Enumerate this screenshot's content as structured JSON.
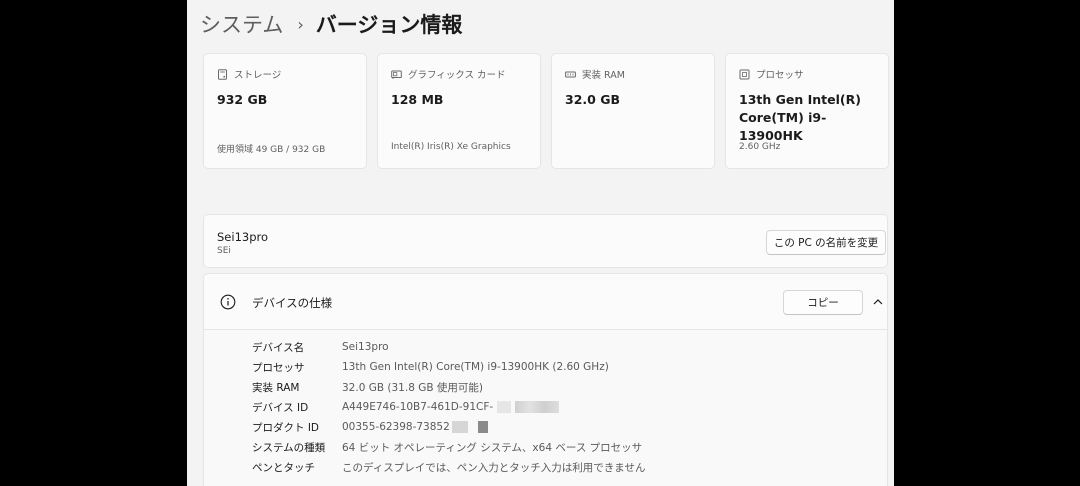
{
  "breadcrumb": {
    "parent": "システム",
    "separator": "›",
    "current": "バージョン情報"
  },
  "cards": [
    {
      "icon": "storage-icon",
      "label": "ストレージ",
      "value": "932 GB",
      "sub": "使用領域 49 GB / 932 GB"
    },
    {
      "icon": "graphics-card-icon",
      "label": "グラフィックス カード",
      "value": "128 MB",
      "sub": "Intel(R) Iris(R) Xe Graphics"
    },
    {
      "icon": "memory-icon",
      "label": "実装 RAM",
      "value": "32.0 GB",
      "sub": ""
    },
    {
      "icon": "processor-icon",
      "label": "プロセッサ",
      "value": "13th Gen Intel(R)\nCore(TM) i9-13900HK",
      "sub": "2.60 GHz"
    }
  ],
  "pc": {
    "name": "Sei13pro",
    "model": "SEi",
    "rename_label": "この PC の名前を変更"
  },
  "device_specs": {
    "title": "デバイスの仕様",
    "copy_label": "コピー",
    "expanded": true,
    "rows": [
      {
        "key": "デバイス名",
        "value": "Sei13pro"
      },
      {
        "key": "プロセッサ",
        "value": "13th Gen Intel(R) Core(TM) i9-13900HK (2.60 GHz)"
      },
      {
        "key": "実装 RAM",
        "value": "32.0 GB (31.8 GB 使用可能)"
      },
      {
        "key": "デバイス ID",
        "value": "A449E746-10B7-461D-91CF-"
      },
      {
        "key": "プロダクト ID",
        "value": "00355-62398-73852"
      },
      {
        "key": "システムの種類",
        "value": "64 ビット オペレーティング システム、x64 ベース プロセッサ"
      },
      {
        "key": "ペンとタッチ",
        "value": "このディスプレイでは、ペン入力とタッチ入力は利用できません"
      }
    ]
  },
  "colors": {
    "window_bg": "#f3f3f3",
    "card_bg": "#fbfbfb",
    "border": "#e5e5e5",
    "text_primary": "#1b1b1b",
    "text_secondary": "#616161"
  }
}
